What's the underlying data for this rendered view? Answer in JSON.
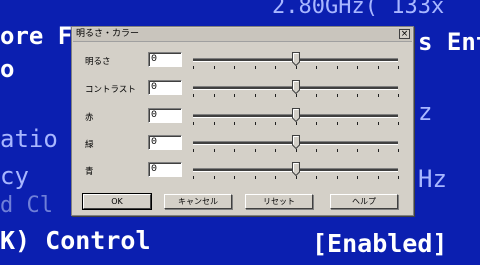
{
  "background": {
    "lines": [
      "2.80GHz( 133x",
      "ore F",
      "o",
      "s Ent",
      "atio",
      "cy",
      "d Cl",
      "K) Control",
      "[Enabled]",
      "z",
      "Hz"
    ]
  },
  "dialog": {
    "title": "明るさ・カラー",
    "close_glyph": "×",
    "rows": [
      {
        "label": "明るさ",
        "value": "0",
        "level": 0.5
      },
      {
        "label": "コントラスト",
        "value": "0",
        "level": 0.5
      },
      {
        "label": "赤",
        "value": "0",
        "level": 0.5
      },
      {
        "label": "緑",
        "value": "0",
        "level": 0.5
      },
      {
        "label": "青",
        "value": "0",
        "level": 0.5
      }
    ],
    "buttons": {
      "ok": "OK",
      "cancel": "キャンセル",
      "reset": "リセット",
      "help": "ヘルプ"
    }
  }
}
